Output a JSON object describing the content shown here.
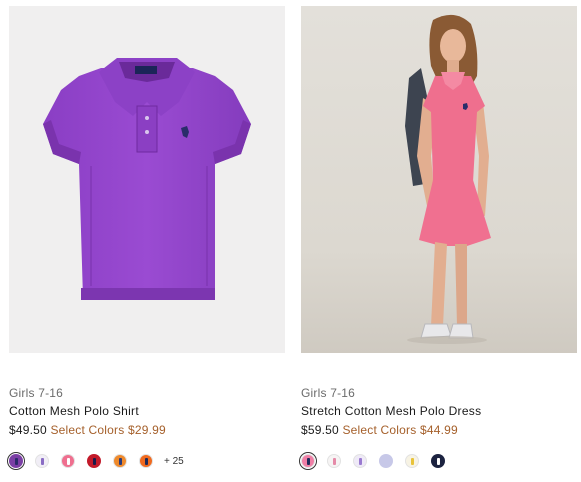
{
  "products": [
    {
      "category": "Girls 7-16",
      "name": "Cotton Mesh Polo Shirt",
      "price": "$49.50",
      "sale_label": "Select Colors",
      "sale_price": "$29.99",
      "more_colors": "+ 25",
      "swatches": [
        {
          "name": "purple",
          "color": "#7b3fa5",
          "pony": "#2a2a6a"
        },
        {
          "name": "white-lavender",
          "color": "#f1eef6",
          "pony": "#8a6cc4"
        },
        {
          "name": "pink",
          "color": "#ef6f8f",
          "pony": "#ffffff"
        },
        {
          "name": "red",
          "color": "#c21a2a",
          "pony": "#1a1a4a"
        },
        {
          "name": "orange",
          "color": "#ef8a2c",
          "pony": "#2a3a7a"
        },
        {
          "name": "bright-orange",
          "color": "#f06a1f",
          "pony": "#1e2a5a"
        }
      ]
    },
    {
      "category": "Girls 7-16",
      "name": "Stretch Cotton Mesh Polo Dress",
      "price": "$59.50",
      "sale_label": "Select Colors",
      "sale_price": "$44.99",
      "swatches": [
        {
          "name": "pink",
          "color": "#ef7fa6",
          "pony": "#1e2a5a"
        },
        {
          "name": "white",
          "color": "#f6f4f4",
          "pony": "#e58aa8"
        },
        {
          "name": "white-lavender",
          "color": "#efeaf7",
          "pony": "#9a7ad0"
        },
        {
          "name": "lavender",
          "color": "#c7c8e8",
          "pony": "#c7c8e8"
        },
        {
          "name": "yellow-white",
          "color": "#f7f3e4",
          "pony": "#e8c33a"
        },
        {
          "name": "navy",
          "color": "#1c2340",
          "pony": "#ffffff"
        }
      ]
    }
  ]
}
